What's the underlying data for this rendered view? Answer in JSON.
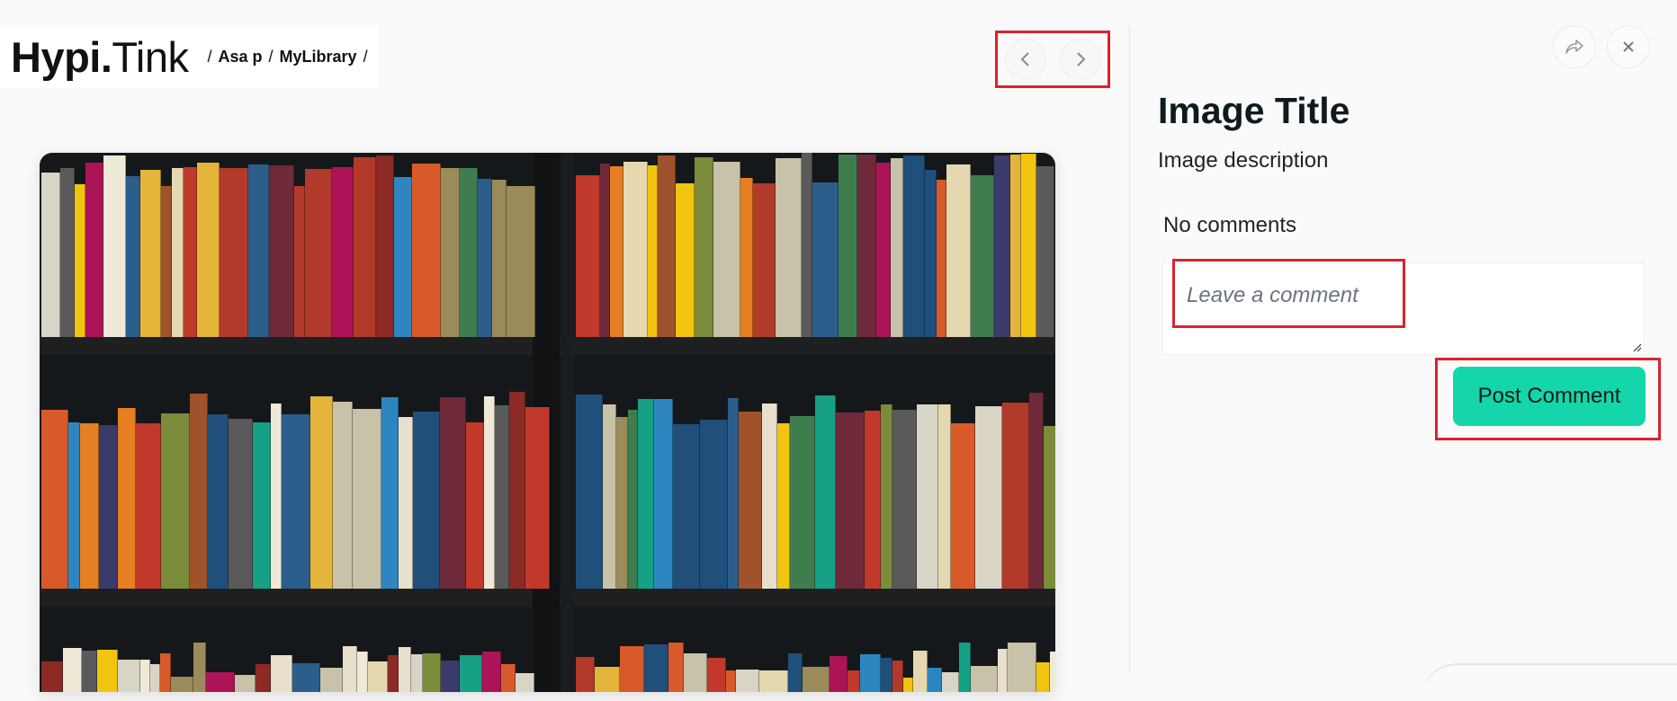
{
  "header": {
    "logo_bold": "Hypi",
    "logo_dot": ".",
    "logo_light": "Tink",
    "breadcrumb": [
      {
        "sep": "/",
        "label": "Asa p"
      },
      {
        "sep": "/",
        "label": "MyLibrary"
      },
      {
        "sep": "/",
        "label": ""
      }
    ]
  },
  "nav": {
    "prev_icon": "chevron-left-icon",
    "next_icon": "chevron-right-icon"
  },
  "viewer": {
    "image_subject": "bookshelf-photo"
  },
  "panel": {
    "share_icon": "share-icon",
    "close_icon": "close-icon",
    "title": "Image Title",
    "description": "Image description",
    "no_comments": "No comments",
    "comment_placeholder": "Leave a comment",
    "post_button": "Post Comment"
  },
  "colors": {
    "accent": "#14d6aa",
    "highlight": "#d9232e",
    "background": "#fafafa",
    "text": "#0e1a20"
  }
}
